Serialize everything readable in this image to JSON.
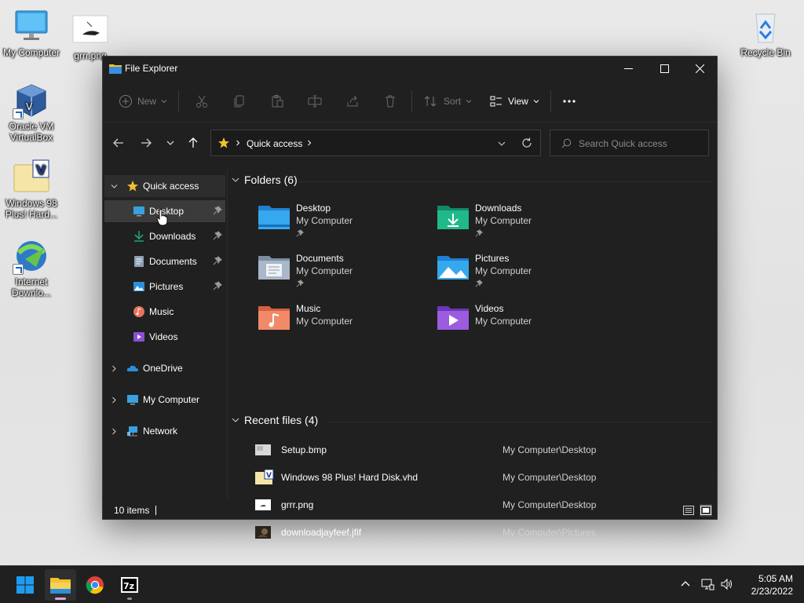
{
  "desktop": {
    "icons": [
      {
        "label": "My Computer",
        "icon": "monitor-icon"
      },
      {
        "label": "grrr.png",
        "icon": "image-file-icon"
      },
      {
        "label": "Oracle VM VirtualBox",
        "icon": "virtualbox-icon"
      },
      {
        "label": "Windows 98 Plus! Hard...",
        "icon": "vhd-file-icon"
      },
      {
        "label": "Internet Downlo...",
        "icon": "download-manager-icon"
      },
      {
        "label": "Recycle Bin",
        "icon": "recycle-bin-icon"
      }
    ]
  },
  "window": {
    "title": "File Explorer",
    "controls": {
      "minimize": "minimize-icon",
      "maximize": "maximize-icon",
      "close": "close-icon"
    }
  },
  "toolbar": {
    "new_label": "New",
    "sort_label": "Sort",
    "view_label": "View",
    "icons": [
      "plus-icon",
      "cut-icon",
      "copy-icon",
      "paste-icon",
      "rename-icon",
      "share-icon",
      "delete-icon",
      "sort-icon",
      "view-icon",
      "more-icon"
    ]
  },
  "address": {
    "crumb": "Quick access",
    "search_placeholder": "Search Quick access"
  },
  "sidebar": {
    "quick_access": "Quick access",
    "items": [
      {
        "label": "Desktop",
        "icon": "desktop-folder-icon",
        "pinned": true
      },
      {
        "label": "Downloads",
        "icon": "downloads-folder-icon",
        "pinned": true
      },
      {
        "label": "Documents",
        "icon": "documents-folder-icon",
        "pinned": true
      },
      {
        "label": "Pictures",
        "icon": "pictures-folder-icon",
        "pinned": true
      },
      {
        "label": "Music",
        "icon": "music-folder-icon",
        "pinned": false
      },
      {
        "label": "Videos",
        "icon": "videos-folder-icon",
        "pinned": false
      }
    ],
    "roots": [
      {
        "label": "OneDrive",
        "icon": "onedrive-icon"
      },
      {
        "label": "My Computer",
        "icon": "monitor-icon"
      },
      {
        "label": "Network",
        "icon": "network-icon"
      }
    ]
  },
  "folders": {
    "header": "Folders (6)",
    "items": [
      {
        "name": "Desktop",
        "location": "My Computer",
        "pinned": true,
        "icon": "desktop-folder-icon"
      },
      {
        "name": "Downloads",
        "location": "My Computer",
        "pinned": true,
        "icon": "downloads-folder-icon"
      },
      {
        "name": "Documents",
        "location": "My Computer",
        "pinned": true,
        "icon": "documents-folder-icon"
      },
      {
        "name": "Pictures",
        "location": "My Computer",
        "pinned": true,
        "icon": "pictures-folder-icon"
      },
      {
        "name": "Music",
        "location": "My Computer",
        "pinned": false,
        "icon": "music-folder-icon"
      },
      {
        "name": "Videos",
        "location": "My Computer",
        "pinned": false,
        "icon": "videos-folder-icon"
      }
    ]
  },
  "recent": {
    "header": "Recent files (4)",
    "items": [
      {
        "name": "Setup.bmp",
        "location": "My Computer\\Desktop",
        "icon": "bitmap-file-icon"
      },
      {
        "name": "Windows 98 Plus! Hard Disk.vhd",
        "location": "My Computer\\Desktop",
        "icon": "vhd-file-icon"
      },
      {
        "name": "grrr.png",
        "location": "My Computer\\Desktop",
        "icon": "image-file-icon"
      },
      {
        "name": "downloadjayfeef.jfif",
        "location": "My Computer\\Pictures",
        "icon": "photo-thumbnail-icon"
      }
    ]
  },
  "status": {
    "count": "10 items"
  },
  "taskbar": {
    "apps": [
      "windows-start-icon",
      "file-explorer-icon",
      "chrome-icon",
      "7zip-icon"
    ],
    "tray": [
      "chevron-up-icon",
      "network-icon",
      "volume-icon"
    ],
    "time": "5:05 AM",
    "date": "2/23/2022"
  },
  "colors": {
    "window_bg": "#202020",
    "selection": "#3b3b3b",
    "folder_blue": "#2d8fd8",
    "downloads_teal": "#1aa37a",
    "star_yellow": "#f2c12e",
    "taskbar": "#202020"
  }
}
